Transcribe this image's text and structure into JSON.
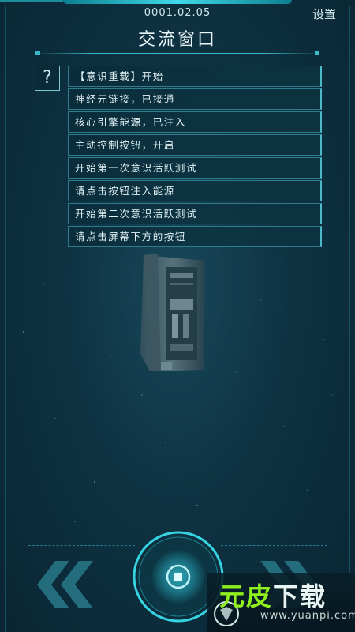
{
  "header": {
    "version": "0001.02.05",
    "settings_label": "设置",
    "title": "交流窗口"
  },
  "help_button": {
    "label": "?"
  },
  "messages": [
    "【意识重载】开始",
    "神经元链接，已接通",
    "核心引擎能源，已注入",
    "主动控制按钮，开启",
    "开始第一次意识活跃测试",
    "请点击按钮注入能源",
    "开始第二次意识活跃测试",
    "请点击屏幕下方的按钮"
  ],
  "watermark": {
    "brand_a": "元皮",
    "brand_b": "下载",
    "url": "www.yuanpi.com"
  },
  "colors": {
    "accent": "#3fd9e8",
    "background": "#0e3242",
    "brand_green": "#8ff01e"
  },
  "icons": {
    "help": "question-icon",
    "left_arrows": "double-chevron-left-icon",
    "right_arrows": "double-chevron-right-icon",
    "center": "stop-square-icon"
  }
}
